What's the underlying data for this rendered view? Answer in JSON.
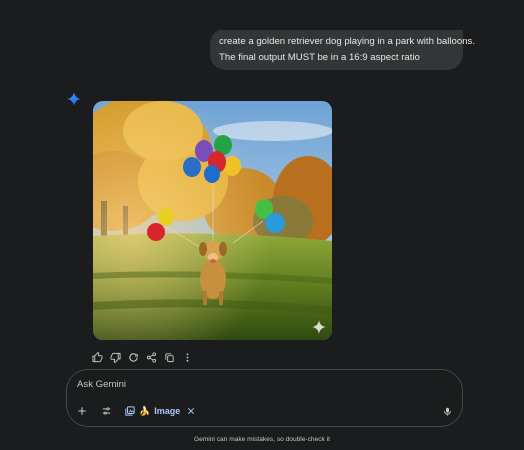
{
  "conversation": {
    "user_message": {
      "line1": "create a golden retriever dog playing in a park with balloons.",
      "line2": "The final output MUST be in a 16:9 aspect ratio"
    },
    "response": {
      "assistant_icon": "gemini-sparkle-icon",
      "image_subject": "golden retriever running in a park with colorful balloons",
      "image_watermark_icon": "sparkle-watermark-icon",
      "actions": [
        "thumbs-up-icon",
        "thumbs-down-icon",
        "regenerate-icon",
        "share-icon",
        "copy-icon",
        "more-options-icon"
      ]
    }
  },
  "composer": {
    "placeholder": "Ask Gemini",
    "tools": {
      "add_icon": "plus-icon",
      "tools_icon": "tools-sliders-icon",
      "mic_icon": "microphone-icon"
    },
    "chip": {
      "icon": "image-gallery-icon",
      "emoji": "🍌",
      "label": "Image",
      "close_icon": "close-icon"
    }
  },
  "footer": {
    "disclaimer": "Gemini can make mistakes, so double-check it"
  },
  "colors": {
    "background": "#1b1c1d",
    "bubble": "#333537",
    "accent": "#a8c7fa",
    "sparkle": "#4c8df6"
  }
}
